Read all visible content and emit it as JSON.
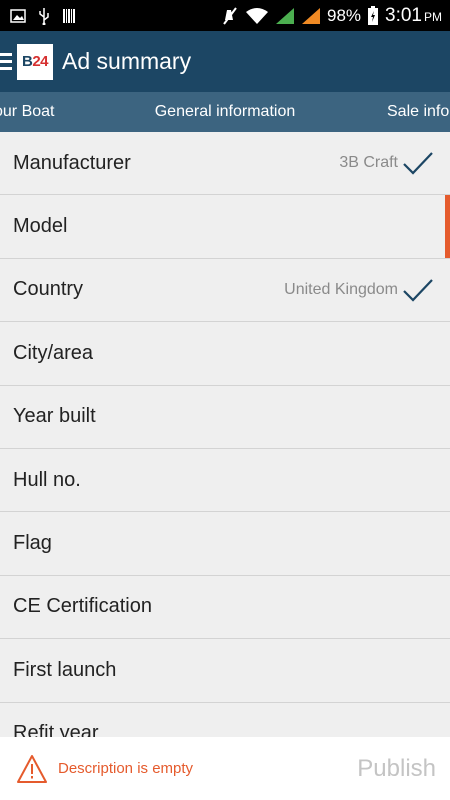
{
  "status_bar": {
    "battery": "98%",
    "time": "3:01",
    "ampm": "PM"
  },
  "app_bar": {
    "logo_letter": "B",
    "logo_number": "24",
    "title": "Ad summary"
  },
  "tabs": [
    {
      "label": "our Boat"
    },
    {
      "label": "General information"
    },
    {
      "label": "Sale infor"
    }
  ],
  "rows": [
    {
      "label": "Manufacturer",
      "value": "3B Craft",
      "checked": true
    },
    {
      "label": "Model",
      "value": "",
      "checked": false
    },
    {
      "label": "Country",
      "value": "United Kingdom",
      "checked": true
    },
    {
      "label": "City/area",
      "value": "",
      "checked": false
    },
    {
      "label": "Year built",
      "value": "",
      "checked": false
    },
    {
      "label": "Hull no.",
      "value": "",
      "checked": false
    },
    {
      "label": "Flag",
      "value": "",
      "checked": false
    },
    {
      "label": "CE Certification",
      "value": "",
      "checked": false
    },
    {
      "label": "First launch",
      "value": "",
      "checked": false
    },
    {
      "label": "Refit year",
      "value": "",
      "checked": false
    }
  ],
  "bottom_bar": {
    "warning": "Description is empty",
    "publish": "Publish"
  },
  "colors": {
    "app_bar": "#1c4664",
    "tabs": "#3c6480",
    "accent": "#e55b2d",
    "check": "#1c4664"
  }
}
